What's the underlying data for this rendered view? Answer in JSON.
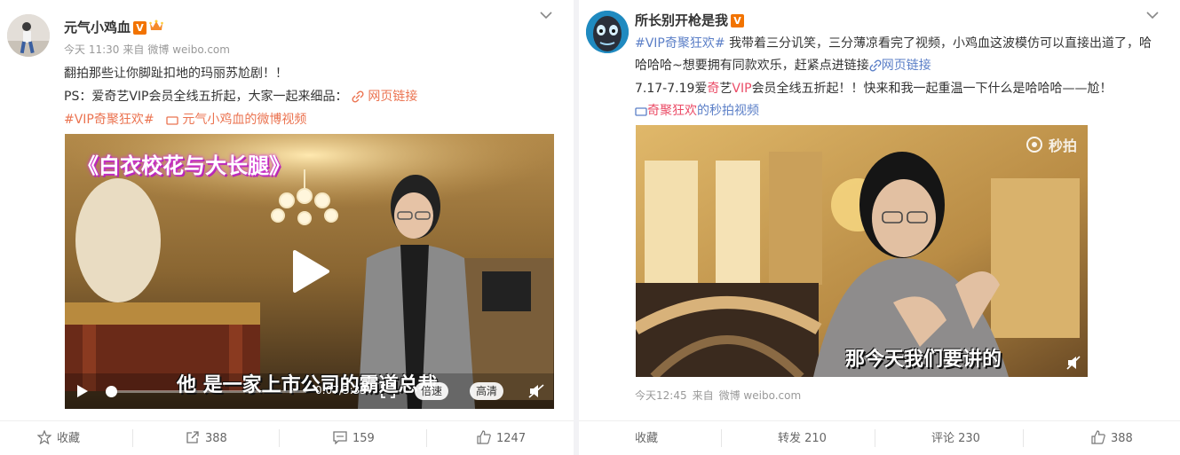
{
  "posts": [
    {
      "username": "元气小鸡血",
      "verified_badge": "V",
      "time": "今天 11:30",
      "via": "来自",
      "source": "微博 weibo.com",
      "line1": "翻拍那些让你脚趾扣地的玛丽苏尬剧！！",
      "line2_text": "PS：爱奇艺VIP会员全线五折起，大家一起来细品：",
      "line2_link": "网页链接",
      "hashtag": "#VIP奇聚狂欢#",
      "video_link": "元气小鸡血的微博视频",
      "video_title": "《白衣校花与大长腿》",
      "subtitle": "他 是一家上市公司的霸道总裁",
      "video_time": "0:07/3:35",
      "speed_label": "倍速",
      "quality_label": "高清",
      "actions": {
        "favorite": "收藏",
        "repost": "388",
        "comment": "159",
        "like": "1247"
      }
    },
    {
      "username": "所长别开枪是我",
      "verified_badge": "V",
      "hashtag": "#VIP奇聚狂欢#",
      "line1_text": "我带着三分讥笑，三分薄凉看完了视频，小鸡血这波模仿可以直接出道了，哈",
      "line2_text": "哈哈哈~想要拥有同款欢乐，赶紧点进链接",
      "line2_link": "网页链接",
      "line3_a": "7.17-7.19爱",
      "line3_b": "奇",
      "line3_c": "艺",
      "line3_d": "VIP",
      "line3_e": "会员全线五折起！！快来和我一起重温一下什么是哈哈哈——尬！",
      "video_link_a": "奇聚狂欢",
      "video_link_b": "的秒拍视频",
      "watermark": "秒拍",
      "subtitle": "那今天我们要讲的",
      "time": "今天12:45",
      "via": "来自",
      "source": "微博 weibo.com",
      "actions": {
        "favorite": "收藏",
        "repost": "转发 210",
        "comment": "评论 230",
        "like": "388"
      }
    }
  ],
  "colors": {
    "link": "#eb7350",
    "link_blue": "#5b7fc7",
    "highlight": "#eb4c67",
    "badge": "#f27300"
  }
}
